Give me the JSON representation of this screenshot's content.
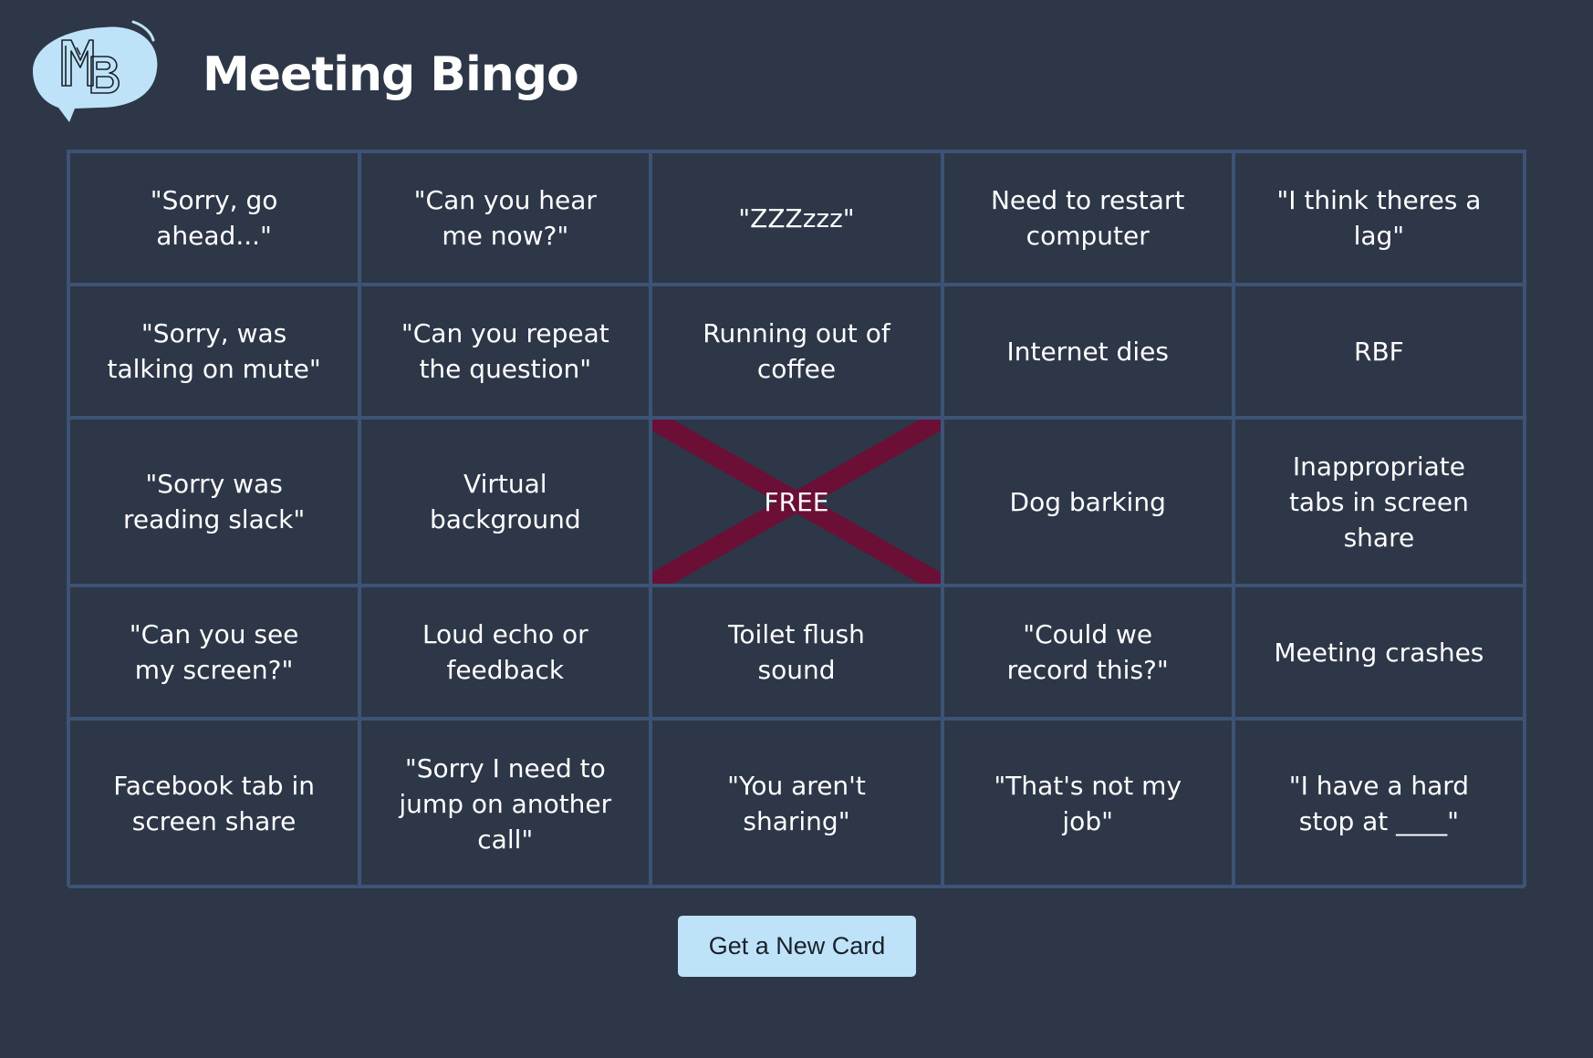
{
  "app": {
    "title": "Meeting Bingo",
    "logo_text": "MB",
    "logo_color": "#bee3f8"
  },
  "board": {
    "marked_color": "#6b0f36",
    "cells": [
      {
        "text": "\"Sorry, go ahead...\"",
        "marked": false
      },
      {
        "text": "\"Can you hear me now?\"",
        "marked": false
      },
      {
        "text": "\"ZZZzzz\"",
        "marked": false
      },
      {
        "text": "Need to restart computer",
        "marked": false
      },
      {
        "text": "\"I think theres a lag\"",
        "marked": false
      },
      {
        "text": "\"Sorry, was talking on mute\"",
        "marked": false
      },
      {
        "text": "\"Can you repeat the question\"",
        "marked": false
      },
      {
        "text": "Running out of coffee",
        "marked": false
      },
      {
        "text": "Internet dies",
        "marked": false
      },
      {
        "text": "RBF",
        "marked": false
      },
      {
        "text": "\"Sorry was reading slack\"",
        "marked": false
      },
      {
        "text": "Virtual background",
        "marked": false
      },
      {
        "text": "FREE",
        "marked": true
      },
      {
        "text": "Dog barking",
        "marked": false
      },
      {
        "text": "Inappropriate tabs in screen share",
        "marked": false
      },
      {
        "text": "\"Can you see my screen?\"",
        "marked": false
      },
      {
        "text": "Loud echo or feedback",
        "marked": false
      },
      {
        "text": "Toilet flush sound",
        "marked": false
      },
      {
        "text": "\"Could we record this?\"",
        "marked": false
      },
      {
        "text": "Meeting crashes",
        "marked": false
      },
      {
        "text": "Facebook tab in screen share",
        "marked": false
      },
      {
        "text": "\"Sorry I need to jump on another call\"",
        "marked": false
      },
      {
        "text": "\"You aren't sharing\"",
        "marked": false
      },
      {
        "text": "\"That's not my job\"",
        "marked": false
      },
      {
        "text": "\"I have a hard stop at ____\"",
        "marked": false
      }
    ]
  },
  "actions": {
    "new_card_label": "Get a New Card"
  }
}
